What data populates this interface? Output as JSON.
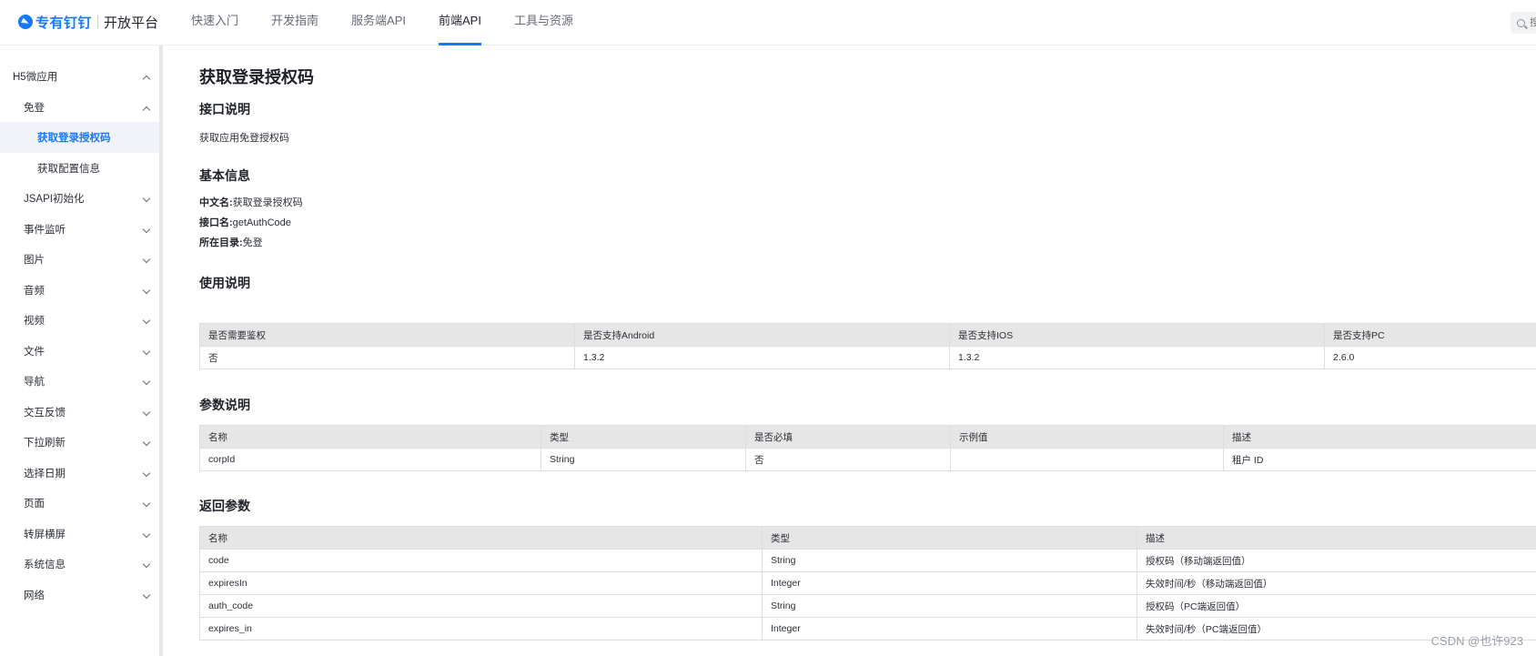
{
  "header": {
    "brand": "专有钉钉",
    "platform": "开放平台",
    "nav": [
      {
        "label": "快速入门",
        "active": false
      },
      {
        "label": "开发指南",
        "active": false
      },
      {
        "label": "服务端API",
        "active": false
      },
      {
        "label": "前端API",
        "active": true
      },
      {
        "label": "工具与资源",
        "active": false
      }
    ],
    "search_placeholder": "搜"
  },
  "sidebar": {
    "items": [
      {
        "label": "H5微应用",
        "level": 0,
        "chevron": "up",
        "active": false
      },
      {
        "label": "免登",
        "level": 1,
        "chevron": "up",
        "active": false
      },
      {
        "label": "获取登录授权码",
        "level": 2,
        "chevron": "",
        "active": true
      },
      {
        "label": "获取配置信息",
        "level": 2,
        "chevron": "",
        "active": false
      },
      {
        "label": "JSAPI初始化",
        "level": 1,
        "chevron": "down",
        "active": false
      },
      {
        "label": "事件监听",
        "level": 1,
        "chevron": "down",
        "active": false
      },
      {
        "label": "图片",
        "level": 1,
        "chevron": "down",
        "active": false
      },
      {
        "label": "音频",
        "level": 1,
        "chevron": "down",
        "active": false
      },
      {
        "label": "视频",
        "level": 1,
        "chevron": "down",
        "active": false
      },
      {
        "label": "文件",
        "level": 1,
        "chevron": "down",
        "active": false
      },
      {
        "label": "导航",
        "level": 1,
        "chevron": "down",
        "active": false
      },
      {
        "label": "交互反馈",
        "level": 1,
        "chevron": "down",
        "active": false
      },
      {
        "label": "下拉刷新",
        "level": 1,
        "chevron": "down",
        "active": false
      },
      {
        "label": "选择日期",
        "level": 1,
        "chevron": "down",
        "active": false
      },
      {
        "label": "页面",
        "level": 1,
        "chevron": "down",
        "active": false
      },
      {
        "label": "转屏横屏",
        "level": 1,
        "chevron": "down",
        "active": false
      },
      {
        "label": "系统信息",
        "level": 1,
        "chevron": "down",
        "active": false
      },
      {
        "label": "网络",
        "level": 1,
        "chevron": "down",
        "active": false
      }
    ]
  },
  "main": {
    "title": "获取登录授权码",
    "intro": {
      "heading": "接口说明",
      "text": "获取应用免登授权码"
    },
    "basic": {
      "heading": "基本信息",
      "rows": [
        {
          "key": "中文名:",
          "value": "获取登录授权码"
        },
        {
          "key": "接口名:",
          "value": "getAuthCode"
        },
        {
          "key": "所在目录:",
          "value": "免登"
        }
      ]
    },
    "usage": {
      "heading": "使用说明",
      "headers": [
        "是否需要鉴权",
        "是否支持Android",
        "是否支持IOS",
        "是否支持PC"
      ],
      "rows": [
        [
          "否",
          "1.3.2",
          "1.3.2",
          "2.6.0"
        ]
      ]
    },
    "params": {
      "heading": "参数说明",
      "headers": [
        "名称",
        "类型",
        "是否必填",
        "示例值",
        "描述"
      ],
      "rows": [
        [
          "corpId",
          "String",
          "否",
          "",
          "租户 ID"
        ]
      ]
    },
    "returns": {
      "heading": "返回参数",
      "headers": [
        "名称",
        "类型",
        "描述"
      ],
      "rows": [
        [
          "code",
          "String",
          "授权码（移动端返回值）"
        ],
        [
          "expiresIn",
          "Integer",
          "失效时间/秒（移动端返回值）"
        ],
        [
          "auth_code",
          "String",
          "授权码（PC端返回值）"
        ],
        [
          "expires_in",
          "Integer",
          "失效时间/秒（PC端返回值）"
        ]
      ]
    }
  },
  "watermark": "CSDN @也许923"
}
